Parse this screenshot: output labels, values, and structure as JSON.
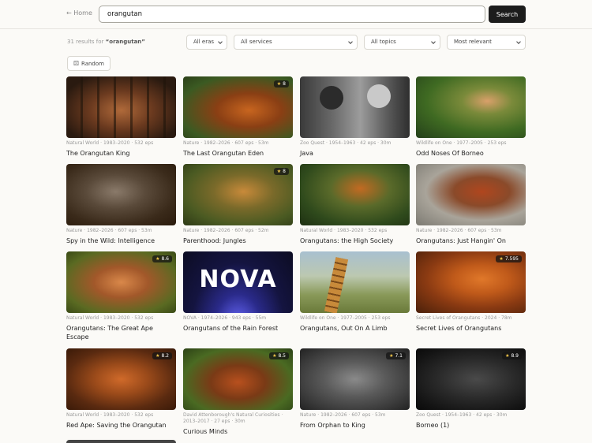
{
  "header": {
    "home_label": "← Home",
    "search_value": "orangutan",
    "search_label": "Search"
  },
  "results": {
    "prefix": "31 results for ",
    "query": "“orangutan”"
  },
  "filters": {
    "eras": "All eras",
    "services": "All services",
    "topics": "All topics",
    "sort": "Most relevant"
  },
  "random_label": "Random",
  "cards": [
    {
      "meta": "Natural World · 1983–2020 · 532 eps",
      "title": "The Orangutan King",
      "rating": ""
    },
    {
      "meta": "Nature · 1982–2026 · 607 eps · 53m",
      "title": "The Last Orangutan Eden",
      "rating": "8"
    },
    {
      "meta": "Zoo Quest · 1954–1963 · 42 eps · 30m",
      "title": "Java",
      "rating": ""
    },
    {
      "meta": "Wildlife on One · 1977–2005 · 253 eps",
      "title": "Odd Noses Of Borneo",
      "rating": ""
    },
    {
      "meta": "Nature · 1982–2026 · 607 eps · 53m",
      "title": "Spy in the Wild: Intelligence",
      "rating": ""
    },
    {
      "meta": "Nature · 1982–2026 · 607 eps · 52m",
      "title": "Parenthood: Jungles",
      "rating": "8"
    },
    {
      "meta": "Natural World · 1983–2020 · 532 eps",
      "title": "Orangutans: the High Society",
      "rating": ""
    },
    {
      "meta": "Nature · 1982–2026 · 607 eps · 53m",
      "title": "Orangutans: Just Hangin' On",
      "rating": ""
    },
    {
      "meta": "Natural World · 1983–2020 · 532 eps",
      "title": "Orangutans: The Great Ape Escape",
      "rating": "8.6"
    },
    {
      "meta": "NOVA · 1974–2026 · 943 eps · 55m",
      "title": "Orangutans of the Rain Forest",
      "rating": ""
    },
    {
      "meta": "Wildlife on One · 1977–2005 · 253 eps",
      "title": "Orangutans, Out On A Limb",
      "rating": ""
    },
    {
      "meta": "Secret Lives of Orangutans · 2024 · 78m",
      "title": "Secret Lives of Orangutans",
      "rating": "7.595"
    },
    {
      "meta": "Natural World · 1983–2020 · 532 eps",
      "title": "Red Ape: Saving the Orangutan",
      "rating": "8.2"
    },
    {
      "meta": "David Attenborough's Natural Curiosities · 2013–2017 · 27 eps · 30m",
      "title": "Curious Minds",
      "rating": "8.5"
    },
    {
      "meta": "Nature · 1982–2026 · 607 eps · 53m",
      "title": "From Orphan to King",
      "rating": "7.1"
    },
    {
      "meta": "Zoo Quest · 1954–1963 · 42 eps · 30m",
      "title": "Borneo (1)",
      "rating": "8.9"
    }
  ],
  "nova_logo": "NOVA",
  "colors": {
    "accent": "#1c1c1c",
    "background": "#fbfaf7",
    "star": "#f3c84b"
  }
}
